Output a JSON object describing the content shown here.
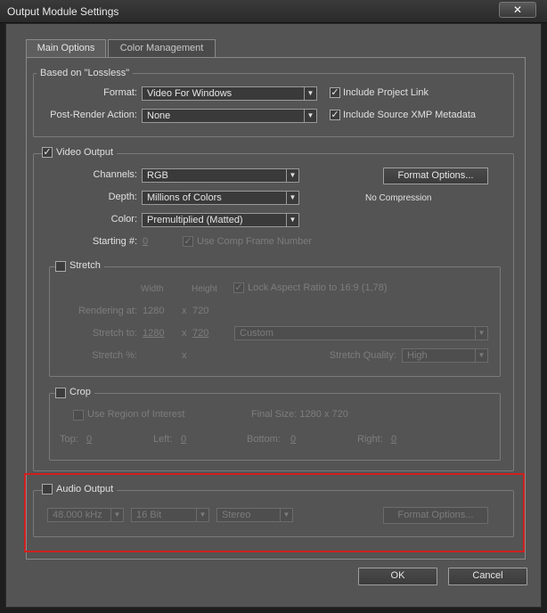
{
  "window": {
    "title": "Output Module Settings",
    "close_glyph": "✕"
  },
  "tabs": [
    {
      "label": "Main Options",
      "active": true
    },
    {
      "label": "Color Management",
      "active": false
    }
  ],
  "based_on": {
    "legend": "Based on \"Lossless\"",
    "format_label": "Format:",
    "format_value": "Video For Windows",
    "post_render_label": "Post-Render Action:",
    "post_render_value": "None",
    "include_project_link": "Include Project Link",
    "include_xmp": "Include Source XMP Metadata"
  },
  "video_output": {
    "legend": "Video Output",
    "channels_label": "Channels:",
    "channels_value": "RGB",
    "depth_label": "Depth:",
    "depth_value": "Millions of Colors",
    "color_label": "Color:",
    "color_value": "Premultiplied (Matted)",
    "format_options": "Format Options...",
    "compression": "No Compression",
    "starting_label": "Starting #:",
    "starting_value": "0",
    "use_comp_frame": "Use Comp Frame Number"
  },
  "stretch": {
    "legend": "Stretch",
    "width_header": "Width",
    "height_header": "Height",
    "lock_aspect": "Lock Aspect Ratio to 16:9 (1,78)",
    "rendering_label": "Rendering at:",
    "rendering_w": "1280",
    "rendering_x": "x",
    "rendering_h": "720",
    "stretch_to_label": "Stretch to:",
    "stretch_w": "1280",
    "stretch_x": "x",
    "stretch_h": "720",
    "stretch_preset": "Custom",
    "stretch_pct_label": "Stretch %:",
    "stretch_pct_x": "x",
    "quality_label": "Stretch Quality:",
    "quality_value": "High"
  },
  "crop": {
    "legend": "Crop",
    "use_roi": "Use Region of Interest",
    "final_size": "Final Size: 1280 x 720",
    "top_label": "Top:",
    "top_value": "0",
    "left_label": "Left:",
    "left_value": "0",
    "bottom_label": "Bottom:",
    "bottom_value": "0",
    "right_label": "Right:",
    "right_value": "0"
  },
  "audio_output": {
    "legend": "Audio Output",
    "rate": "48.000 kHz",
    "bits": "16 Bit",
    "channels": "Stereo",
    "format_options": "Format Options..."
  },
  "footer": {
    "ok": "OK",
    "cancel": "Cancel"
  },
  "icons": {
    "check": "✓",
    "arrow": "▼"
  },
  "colors": {
    "highlight": "#d01f1f"
  }
}
